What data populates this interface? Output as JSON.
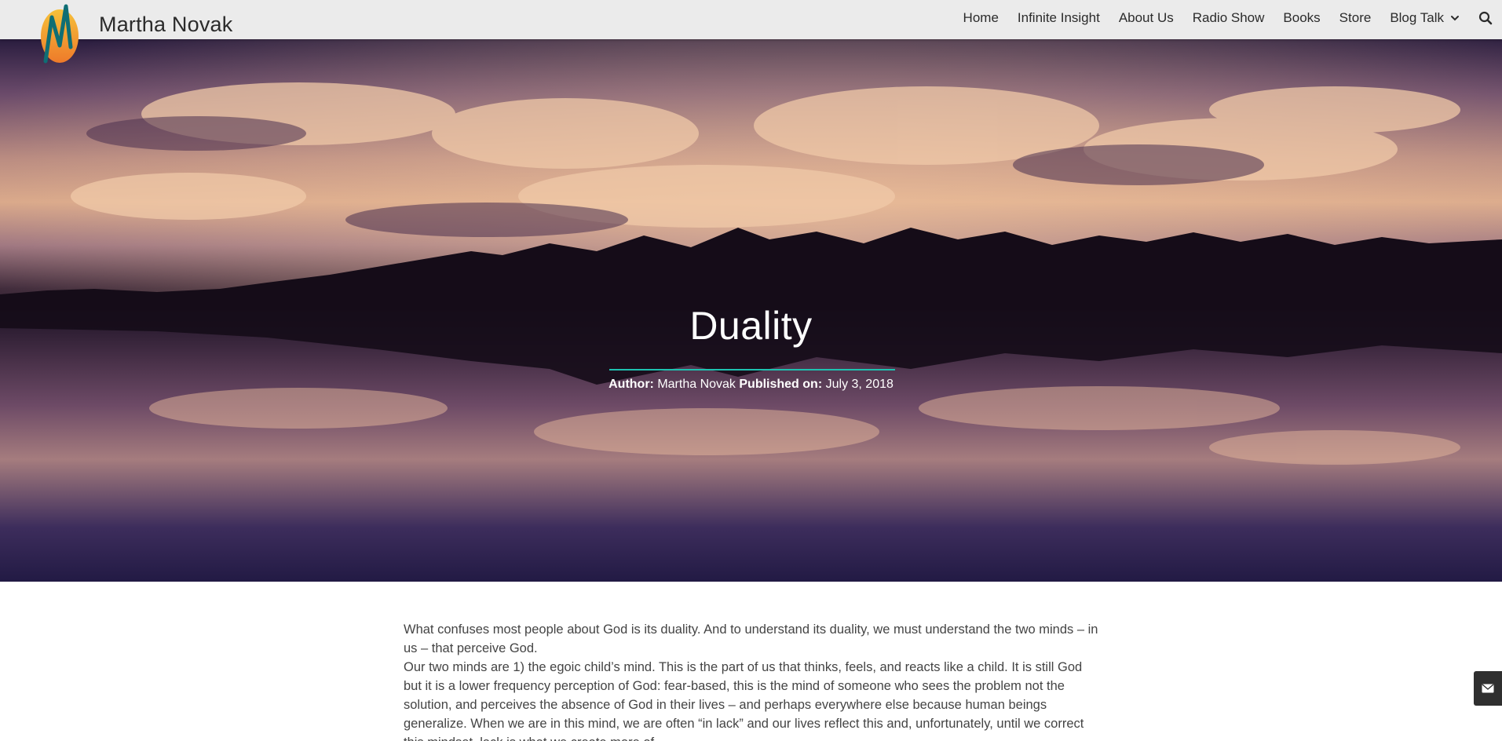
{
  "site": {
    "title": "Martha Novak",
    "logo_icon": "martha-novak-logo"
  },
  "nav": {
    "items": [
      {
        "label": "Home"
      },
      {
        "label": "Infinite Insight"
      },
      {
        "label": "About Us"
      },
      {
        "label": "Radio Show"
      },
      {
        "label": "Books"
      },
      {
        "label": "Store"
      },
      {
        "label": "Blog Talk",
        "has_dropdown": true
      }
    ],
    "search_icon": "search-icon"
  },
  "hero": {
    "title": "Duality",
    "author_label": "Author:",
    "author": "Martha Novak",
    "published_label": "Published on:",
    "published": "July 3, 2018",
    "accent_color": "#1ec2b0"
  },
  "article": {
    "paragraphs": [
      "What confuses most people about God is its duality. And to understand its duality, we must understand the two minds – in us – that perceive God.",
      "Our two minds are 1) the egoic child’s mind. This is the part of us that thinks, feels, and reacts like a child. It is still God but it is a lower frequency perception of God: fear-based, this is the mind of someone who sees the problem not the solution, and perceives the absence of God in their lives – and perhaps everywhere else because human beings generalize. When we are in this mind, we are often “in lack” and our lives reflect this and, unfortunately, until we correct this mindset, lack is what we create more of."
    ]
  },
  "contact_tab": {
    "icon": "envelope-icon"
  }
}
